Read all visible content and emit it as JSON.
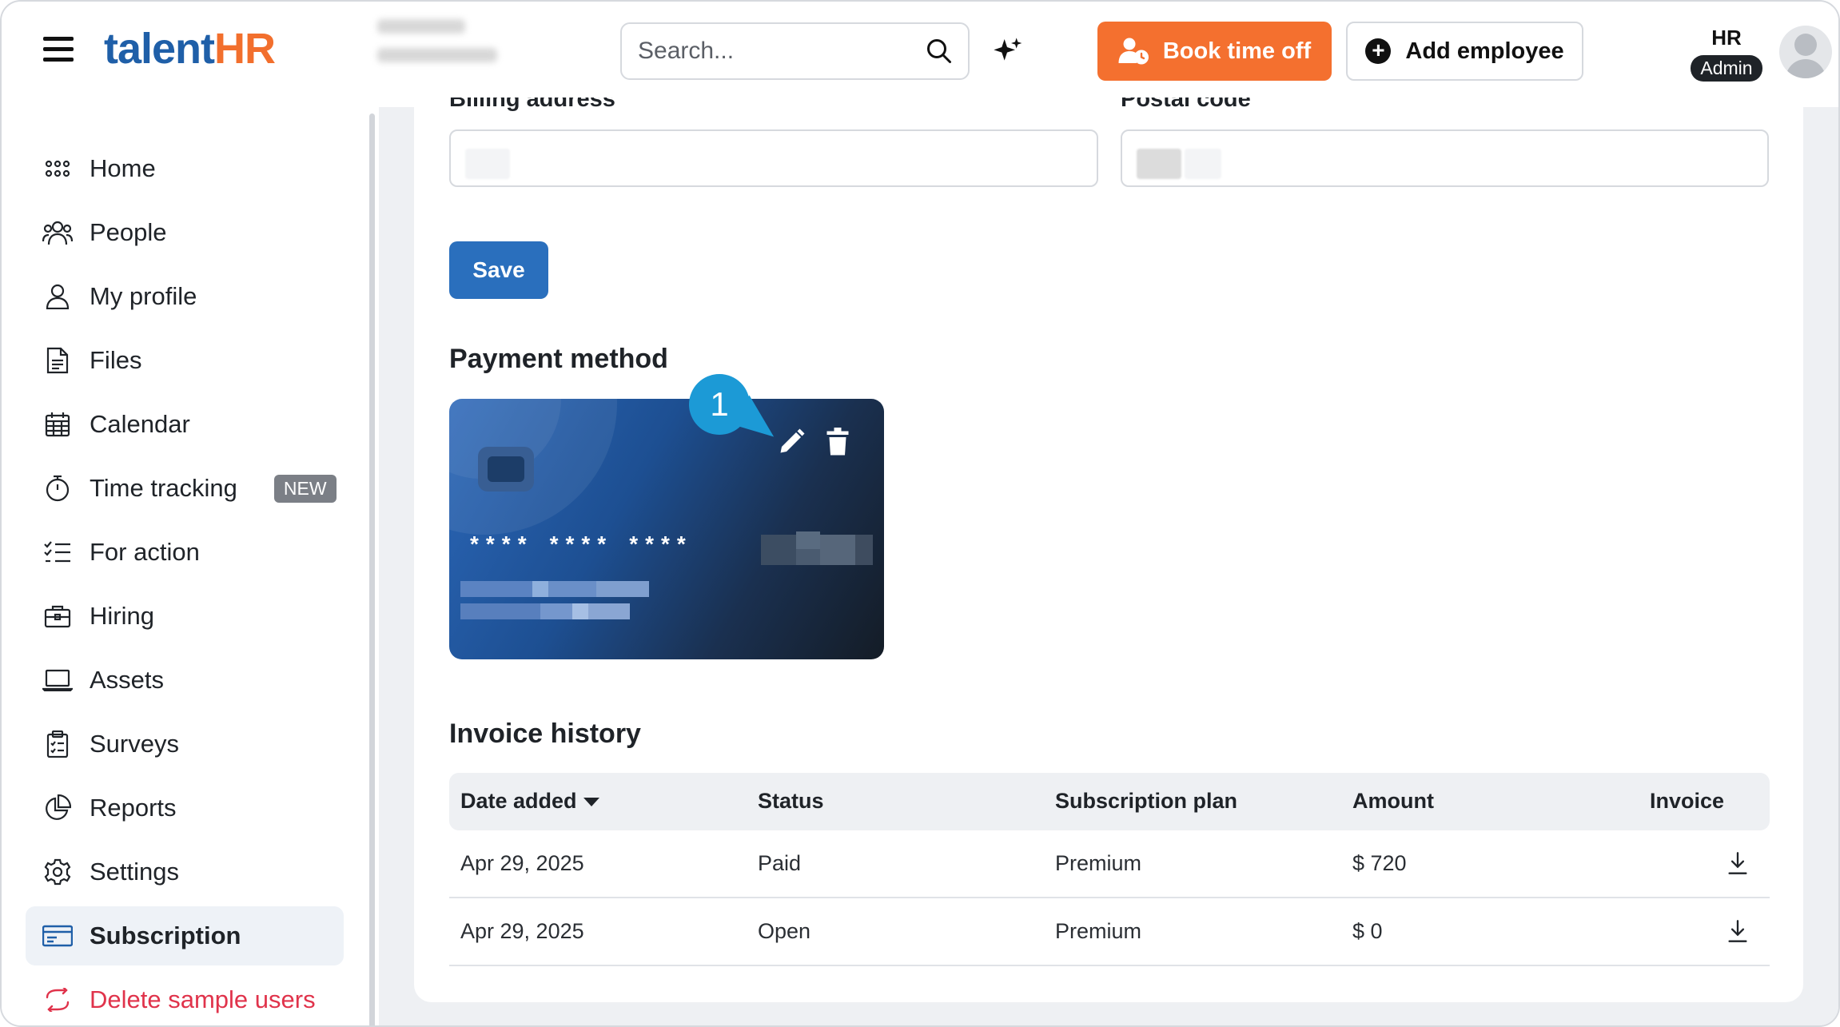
{
  "header": {
    "logo_talent": "talent",
    "logo_hr": "HR",
    "search_placeholder": "Search...",
    "book_time_off": "Book time off",
    "add_employee": "Add employee",
    "role": "HR",
    "role_badge": "Admin"
  },
  "sidebar": {
    "items": [
      {
        "label": "Home",
        "icon": "grid-icon"
      },
      {
        "label": "People",
        "icon": "people-icon"
      },
      {
        "label": "My profile",
        "icon": "user-icon"
      },
      {
        "label": "Files",
        "icon": "file-icon"
      },
      {
        "label": "Calendar",
        "icon": "calendar-icon"
      },
      {
        "label": "Time tracking",
        "icon": "stopwatch-icon",
        "badge": "NEW"
      },
      {
        "label": "For action",
        "icon": "checklist-icon"
      },
      {
        "label": "Hiring",
        "icon": "briefcase-icon"
      },
      {
        "label": "Assets",
        "icon": "laptop-icon"
      },
      {
        "label": "Surveys",
        "icon": "clipboard-icon"
      },
      {
        "label": "Reports",
        "icon": "pie-chart-icon"
      },
      {
        "label": "Settings",
        "icon": "gear-icon"
      },
      {
        "label": "Subscription",
        "icon": "credit-card-icon",
        "active": true
      },
      {
        "label": "Delete sample users",
        "icon": "refresh-icon",
        "danger": true
      }
    ]
  },
  "billing": {
    "billing_address_label": "Billing address",
    "postal_code_label": "Postal code",
    "save_label": "Save"
  },
  "payment": {
    "title": "Payment method",
    "masked_groups": [
      "****",
      "****",
      "****"
    ],
    "callout_number": "1"
  },
  "invoices": {
    "title": "Invoice history",
    "columns": [
      "Date added",
      "Status",
      "Subscription plan",
      "Amount",
      "Invoice"
    ],
    "rows": [
      {
        "date": "Apr 29, 2025",
        "status": "Paid",
        "plan": "Premium",
        "amount": "$ 720"
      },
      {
        "date": "Apr 29, 2025",
        "status": "Open",
        "plan": "Premium",
        "amount": "$ 0"
      }
    ]
  },
  "colors": {
    "brand_blue": "#1f5fa8",
    "brand_orange": "#f26f2d",
    "primary_button": "#2a6fbd",
    "danger": "#e0334b",
    "callout": "#1c9ad6"
  }
}
